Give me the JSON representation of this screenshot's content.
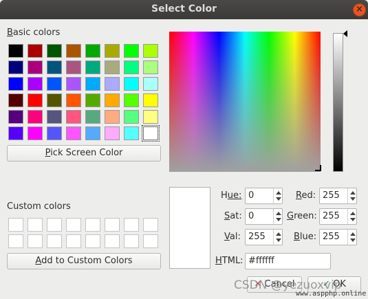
{
  "window": {
    "title": "Select Color"
  },
  "basic_colors": {
    "label_mnemonic": "B",
    "label_rest": "asic colors",
    "rows": [
      [
        "#000000",
        "#aa0000",
        "#005500",
        "#aa5500",
        "#00aa00",
        "#aaaa00",
        "#00ff00",
        "#aaff00"
      ],
      [
        "#00007f",
        "#aa007f",
        "#00557f",
        "#aa557f",
        "#00aa7f",
        "#aaaa7f",
        "#00ff7f",
        "#aaff7f"
      ],
      [
        "#0000ff",
        "#aa00ff",
        "#0055ff",
        "#aa55ff",
        "#00aaff",
        "#aaaaff",
        "#00ffff",
        "#aaffff"
      ],
      [
        "#550000",
        "#ff0000",
        "#555500",
        "#ff5500",
        "#55aa00",
        "#ffaa00",
        "#55ff00",
        "#ffff00"
      ],
      [
        "#55007f",
        "#ff007f",
        "#55557f",
        "#ff557f",
        "#55aa7f",
        "#ffaa7f",
        "#55ff7f",
        "#ffff7f"
      ],
      [
        "#5500ff",
        "#ff00ff",
        "#5555ff",
        "#ff55ff",
        "#55aaff",
        "#ffaaff",
        "#55ffff",
        "#ffffff"
      ]
    ],
    "selected": "#ffffff"
  },
  "pick_screen": {
    "mnemonic": "P",
    "rest": "ick Screen Color"
  },
  "custom_colors": {
    "label": "Custom colors",
    "slot_color": "#ffffff"
  },
  "add_custom": {
    "mnemonic": "A",
    "rest": "dd to Custom Colors"
  },
  "fields": {
    "hue": {
      "mnemonic": "H",
      "rest": "ue:",
      "value": "0"
    },
    "sat": {
      "mnemonic": "S",
      "rest": "at:",
      "value": "0"
    },
    "val": {
      "mnemonic": "V",
      "rest": "al:",
      "value": "255"
    },
    "red": {
      "mnemonic": "R",
      "rest": "ed:",
      "value": "255"
    },
    "green": {
      "mnemonic": "G",
      "rest": "reen:",
      "value": "255"
    },
    "blue": {
      "mnemonic": "B",
      "rest": "lue:",
      "value": "255"
    },
    "html": {
      "mnemonic": "H",
      "rest": "TML:",
      "value": "#ffffff"
    }
  },
  "current_color": "#ffffff",
  "buttons": {
    "cancel": "Cancel",
    "ok": "OK"
  },
  "watermark": {
    "text": "CSDN @yezuoxvip",
    "site": "www.aspphp.online"
  }
}
